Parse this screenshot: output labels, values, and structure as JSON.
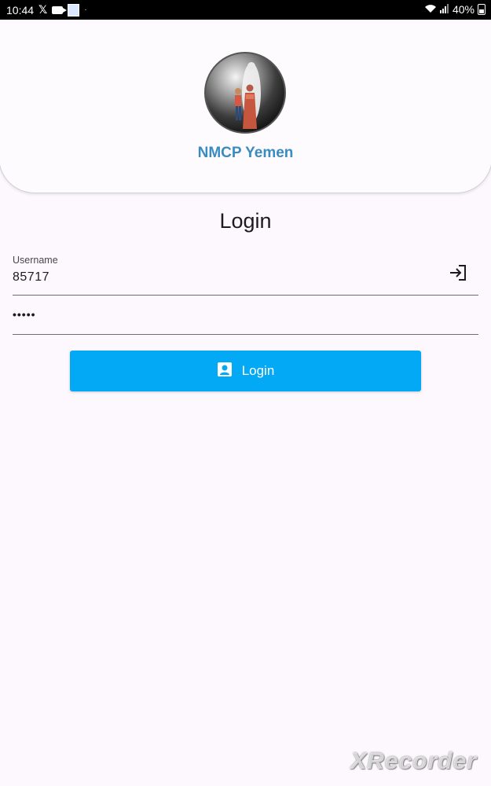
{
  "status_bar": {
    "time": "10:44",
    "battery": "40%",
    "icons": [
      "x-icon",
      "video-icon",
      "app-notification-icon",
      "dot-icon",
      "wifi-icon",
      "signal-icon",
      "battery-icon"
    ]
  },
  "header": {
    "app_name": "NMCP Yemen",
    "logo": "nmcp-family-logo"
  },
  "login": {
    "title": "Login",
    "username_label": "Username",
    "username_value": "85717",
    "password_value": "•••••",
    "button_label": "Login",
    "trailing_icon": "login-icon",
    "button_icon": "account-box-icon"
  },
  "colors": {
    "primary": "#03a9f4",
    "brand_text": "#3a8bbf",
    "background": "#fcf8fd"
  },
  "watermark": {
    "text": "XRecorder"
  }
}
